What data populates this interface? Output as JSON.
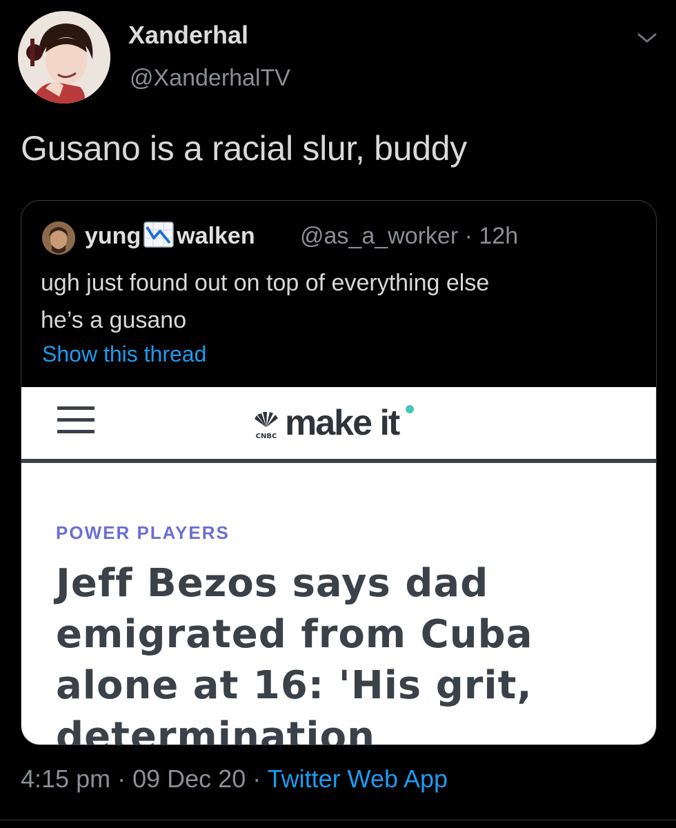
{
  "tweet": {
    "author": {
      "display_name": "Xanderhal",
      "handle": "@XanderhalTV"
    },
    "text": "Gusano is a racial slur, buddy",
    "menu_icon": "chevron-down-icon",
    "timestamp": "4:15 pm",
    "date": "09 Dec 20",
    "separator": "·",
    "source": "Twitter Web App"
  },
  "quote": {
    "name_part1": "yung",
    "name_emoji": "chart-decreasing-icon",
    "name_part2": "walken",
    "handle_time": "@as_a_worker · 12h",
    "line1": "ugh just found out on top of everything else",
    "line2": "he’s a gusano",
    "show_thread": "Show this thread"
  },
  "preview": {
    "brand_small": "CNBC",
    "brand": "make it",
    "kicker": "POWER PLAYERS",
    "headline_lines": [
      "Jeff Bezos says dad",
      "emigrated from Cuba",
      "alone at 16: 'His grit,",
      "determination"
    ]
  },
  "colors": {
    "background": "#000000",
    "link": "#1d9bf0",
    "kicker": "#6b6fd6",
    "headline": "#3b4148"
  }
}
